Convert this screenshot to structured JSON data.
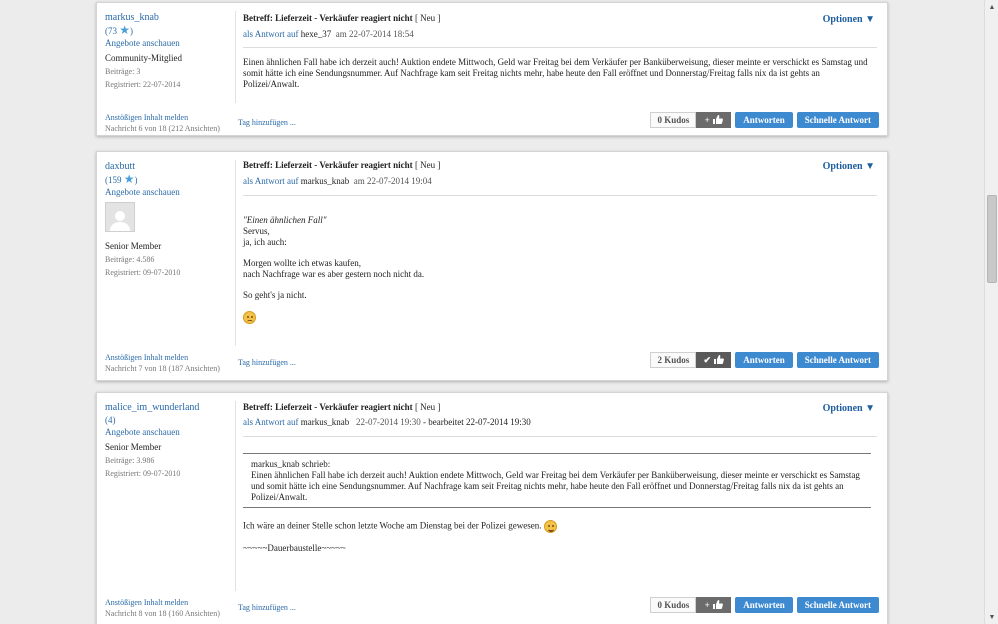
{
  "common": {
    "options_label": "Optionen",
    "reply_link": "als Antwort auf",
    "report_label": "Anstößigen Inhalt melden",
    "tag_label": "Tag hinzufügen ...",
    "reply_button": "Antworten",
    "quick_reply_button": "Schnelle Antwort",
    "neu_label": "[ Neu ]",
    "offers_label": "Angebote anschauen",
    "subject_text": "Betreff: Lieferzeit - Verkäufer reagiert nicht"
  },
  "posts": [
    {
      "username": "markus_knab",
      "score": "(73",
      "score_close": ")",
      "rank": "Community-Mitglied",
      "posts_count": "Beiträge: 3",
      "registered": "Registriert: 22-07-2014",
      "reply_to": "hexe_37",
      "date": "22-07-2014 18:54",
      "body": [
        "Einen ähnlichen Fall habe ich derzeit auch! Auktion endete Mittwoch, Geld war Freitag bei dem Verkäufer per Banküberweisung, dieser meinte er verschickt es Samstag und somit hätte ich eine Sendungsnummer. Auf Nachfrage kam seit Freitag nichts mehr, habe heute den Fall eröffnet und Donnerstag/Freitag falls nix da ist gehts an Polizei/Anwalt."
      ],
      "message_count": "Nachricht 6 von 18 (212 Ansichten)",
      "kudos": "0 Kudos",
      "kudos_icon": "plus-thumbs-up-icon"
    },
    {
      "username": "daxbutt",
      "score": "(159",
      "score_close": ")",
      "rank": "Senior Member",
      "posts_count": "Beiträge: 4.586",
      "registered": "Registriert: 09-07-2010",
      "reply_to": "markus_knab",
      "date": "22-07-2014 19:04",
      "quote_title": "\"Einen ähnlichen Fall\"",
      "body": [
        "Servus,",
        "ja, ich auch:",
        "Morgen wollte ich etwas kaufen,",
        "nach Nachfrage war es aber gestern noch nicht da.",
        "So geht's ja nicht."
      ],
      "message_count": "Nachricht 7 von 18 (187 Ansichten)",
      "kudos": "2 Kudos",
      "kudos_icon": "check-thumbs-up-icon"
    },
    {
      "username": "malice_im_wunderland",
      "score": "(4)",
      "rank": "Senior Member",
      "posts_count": "Beiträge: 3.986",
      "registered": "Registriert: 09-07-2010",
      "reply_to": "markus_knab",
      "date": "22-07-2014 19:30",
      "edited": "- bearbeitet 22-07-2014 19:30",
      "quote_author": "markus_knab schrieb:",
      "quote_body": "Einen ähnlichen Fall habe ich derzeit auch! Auktion endete Mittwoch, Geld war Freitag bei dem Verkäufer per Banküberweisung, dieser meinte er verschickt es Samstag und somit hätte ich eine Sendungsnummer. Auf Nachfrage kam seit Freitag nichts mehr, habe heute den Fall eröffnet und Donnerstag/Freitag falls nix da ist gehts an Polizei/Anwalt.",
      "body": [
        "Ich wäre an deiner Stelle schon letzte Woche am Dienstag bei der Polizei gewesen.",
        "~~~~~Dauerbaustelle~~~~~"
      ],
      "message_count": "Nachricht 8 von 18 (160 Ansichten)",
      "kudos": "0 Kudos",
      "kudos_icon": "plus-thumbs-up-icon"
    }
  ]
}
